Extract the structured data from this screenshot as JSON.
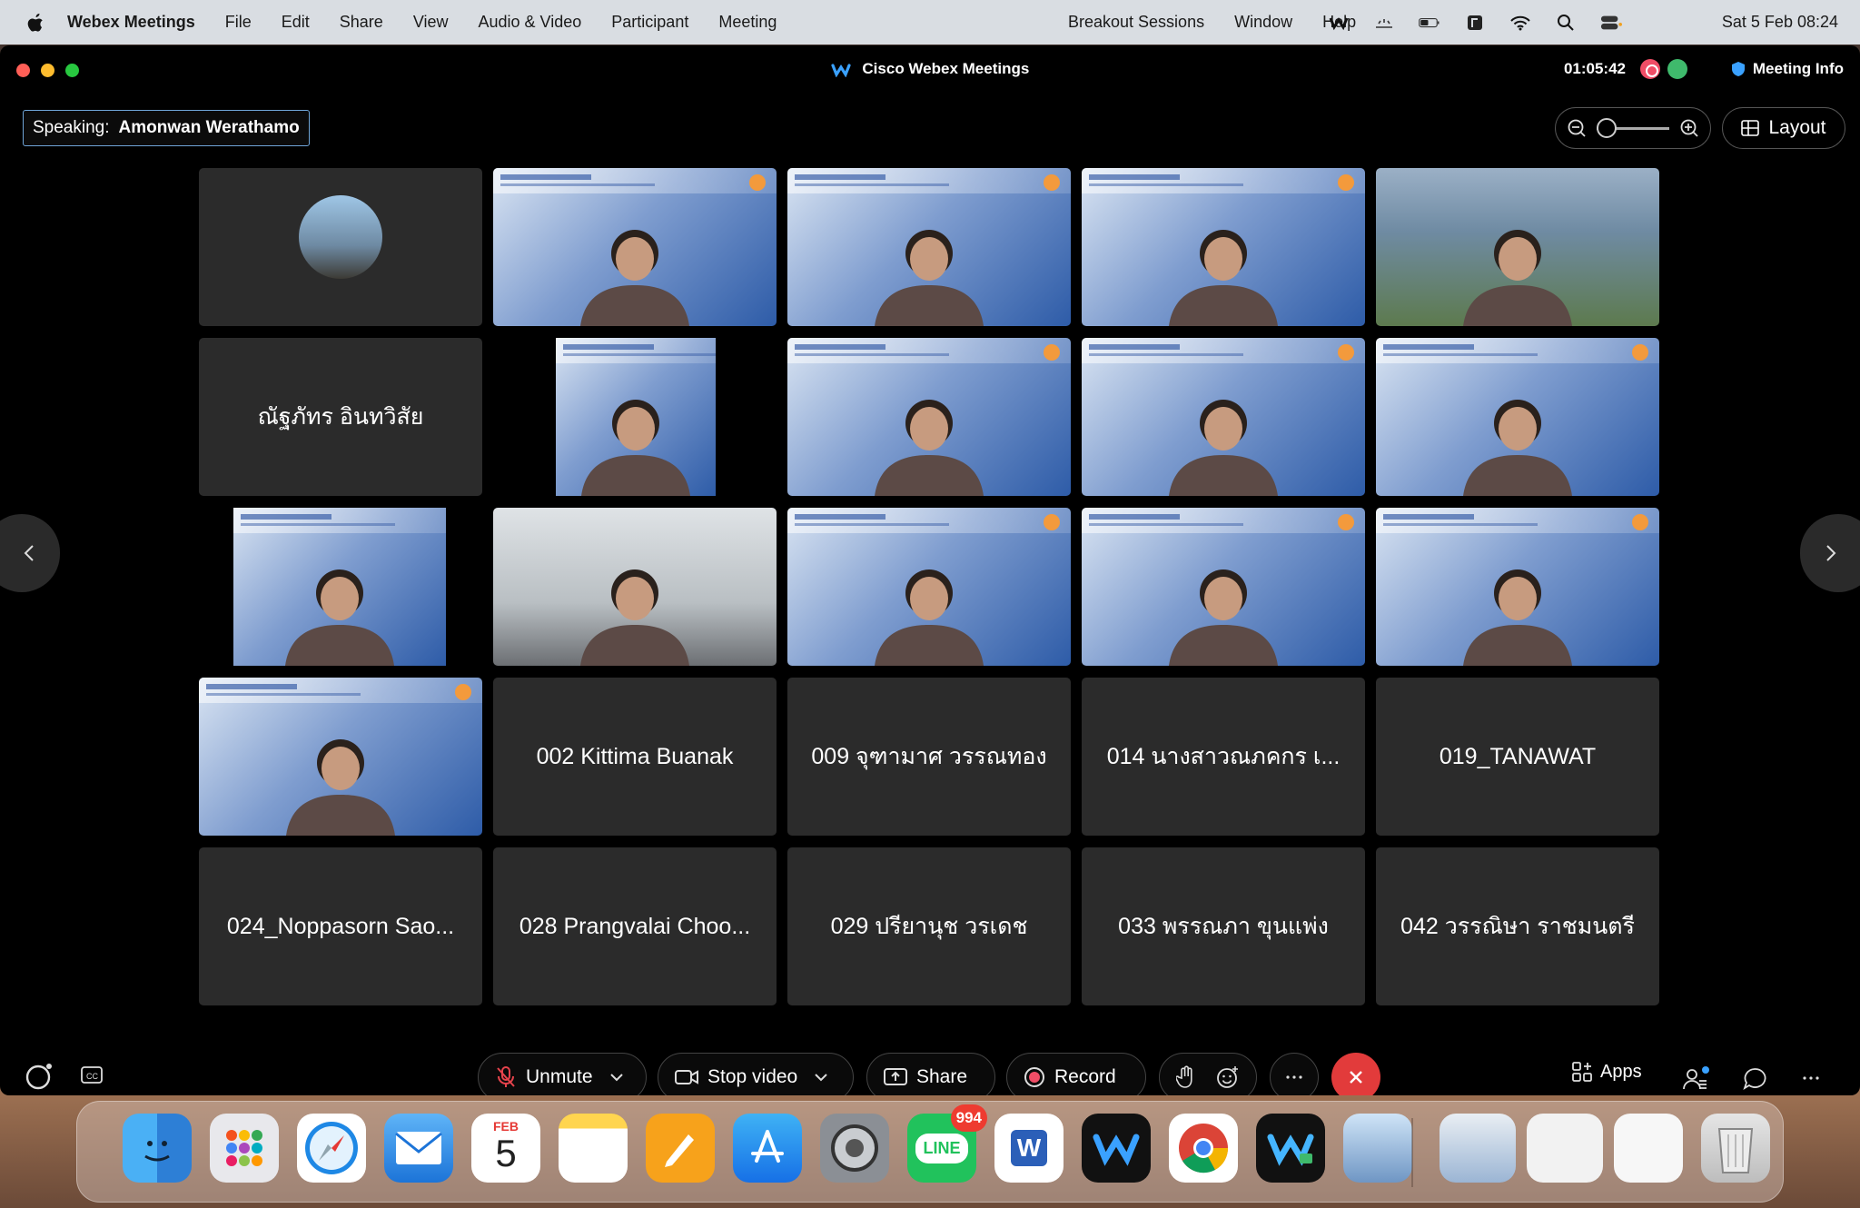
{
  "menubar": {
    "app_name": "Webex Meetings",
    "menus": [
      "File",
      "Edit",
      "Share",
      "View",
      "Audio & Video",
      "Participant",
      "Meeting"
    ],
    "menus_right": [
      "Breakout Sessions",
      "Window",
      "Help"
    ],
    "clock": "Sat 5 Feb  08:24"
  },
  "window": {
    "title": "Cisco Webex Meetings",
    "timer": "01:05:42",
    "meeting_info": "Meeting Info",
    "speaking_prefix": "Speaking:",
    "speaking_name": "Amonwan Werathamo",
    "layout_label": "Layout"
  },
  "tiles": [
    {
      "kind": "avatar"
    },
    {
      "kind": "video"
    },
    {
      "kind": "video"
    },
    {
      "kind": "video"
    },
    {
      "kind": "video-scenic"
    },
    {
      "kind": "name",
      "label": "ณัฐภัทร อินทวิสัย"
    },
    {
      "kind": "video-narrow"
    },
    {
      "kind": "video"
    },
    {
      "kind": "video"
    },
    {
      "kind": "video"
    },
    {
      "kind": "video-narrow"
    },
    {
      "kind": "video-office"
    },
    {
      "kind": "video"
    },
    {
      "kind": "video"
    },
    {
      "kind": "video"
    },
    {
      "kind": "video"
    },
    {
      "kind": "name",
      "label": "002 Kittima Buanak"
    },
    {
      "kind": "name",
      "label": "009 จุฑามาศ วรรณทอง"
    },
    {
      "kind": "name",
      "label": "014 นางสาวณภคกร เ..."
    },
    {
      "kind": "name",
      "label": "019_TANAWAT"
    },
    {
      "kind": "name",
      "label": "024_Noppasorn Sao..."
    },
    {
      "kind": "name",
      "label": "028 Prangvalai Choo..."
    },
    {
      "kind": "name",
      "label": "029 ปรียานุช วรเดช"
    },
    {
      "kind": "name",
      "label": "033 พรรณภา ขุนแพ่ง"
    },
    {
      "kind": "name",
      "label": "042 วรรณิษา ราชมนตรี"
    }
  ],
  "controls": {
    "unmute": "Unmute",
    "stop_video": "Stop video",
    "share": "Share",
    "record": "Record",
    "apps": "Apps"
  },
  "dock": {
    "calendar_month": "FEB",
    "calendar_day": "5",
    "line_label": "LINE",
    "line_badge": "994",
    "word_label": "W"
  },
  "colors": {
    "end_call": "#e23b3b",
    "record_dot": "#f04d66",
    "speaking_border": "#6fa5d8"
  }
}
